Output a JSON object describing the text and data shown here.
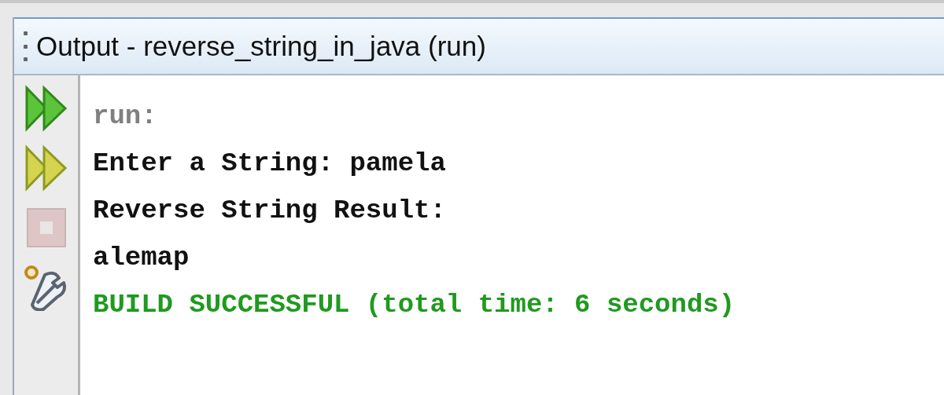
{
  "panel": {
    "title": "Output - reverse_string_in_java (run)"
  },
  "toolbar": [
    {
      "kind": "rerun",
      "disabled": false
    },
    {
      "kind": "rerun-options",
      "disabled": false
    },
    {
      "kind": "stop",
      "disabled": true
    },
    {
      "kind": "settings",
      "disabled": false
    }
  ],
  "output_lines": [
    {
      "kind": "info",
      "text": "run:"
    },
    {
      "kind": "normal",
      "text": "Enter a String: pamela"
    },
    {
      "kind": "normal",
      "text": "Reverse String Result:"
    },
    {
      "kind": "normal",
      "text": "alemap"
    },
    {
      "kind": "success",
      "text": "BUILD SUCCESSFUL (total time: 6 seconds)"
    }
  ]
}
